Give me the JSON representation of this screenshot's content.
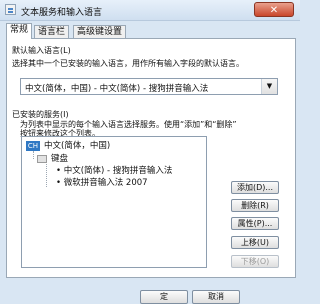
{
  "window": {
    "title": "文本服务和输入语言",
    "close_glyph": "✕"
  },
  "tabs": [
    "常规",
    "语言栏",
    "高级键设置"
  ],
  "default_language": {
    "heading": "默认输入语言(L)",
    "description": "选择其中一个已安装的输入语言，用作所有输入字段的默认语言。",
    "selected": "中文(简体，中国) - 中文(简体) - 搜狗拼音输入法"
  },
  "installed_services": {
    "heading": "已安装的服务(I)",
    "description_line1": "为列表中显示的每个输入语言选择服务。使用“添加”和“删除”",
    "description_line2": "按钮来修改这个列表。",
    "tree": {
      "language_icon_text": "CH",
      "language": "中文(简体，中国)",
      "category": "键盘",
      "items": [
        "中文(简体) - 搜狗拼音输入法",
        "微软拼音输入法 2007"
      ]
    }
  },
  "buttons": {
    "add": "添加(D)...",
    "remove": "删除(R)",
    "properties": "属性(P)...",
    "move_up": "上移(U)",
    "move_down": "下移(O)"
  },
  "bottom_buttons": {
    "ok_partial": "定",
    "cancel_partial": "取消"
  }
}
